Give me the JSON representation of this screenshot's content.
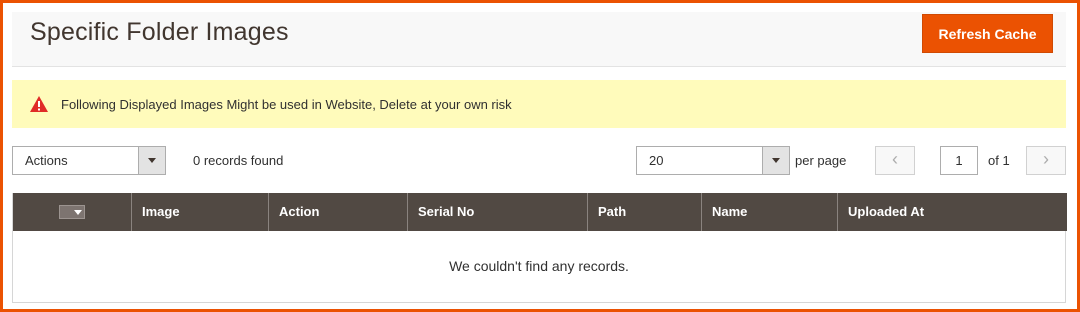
{
  "header": {
    "title": "Specific Folder Images",
    "refresh_button": "Refresh Cache"
  },
  "notice": {
    "icon": "warning-icon",
    "message": "Following Displayed Images Might be used in Website, Delete at your own risk",
    "color": "#fffbbb"
  },
  "toolbar": {
    "actions_value": "Actions",
    "records_text": "0 records found",
    "per_page_value": "20",
    "per_page_label": "per page",
    "current_page": "1",
    "total_pages_label": "of 1"
  },
  "grid": {
    "columns": [
      "",
      "Image",
      "Action",
      "Serial No",
      "Path",
      "Name",
      "Uploaded At"
    ],
    "empty_message": "We couldn't find any records.",
    "header_color": "#514943"
  },
  "colors": {
    "accent": "#eb5202"
  }
}
